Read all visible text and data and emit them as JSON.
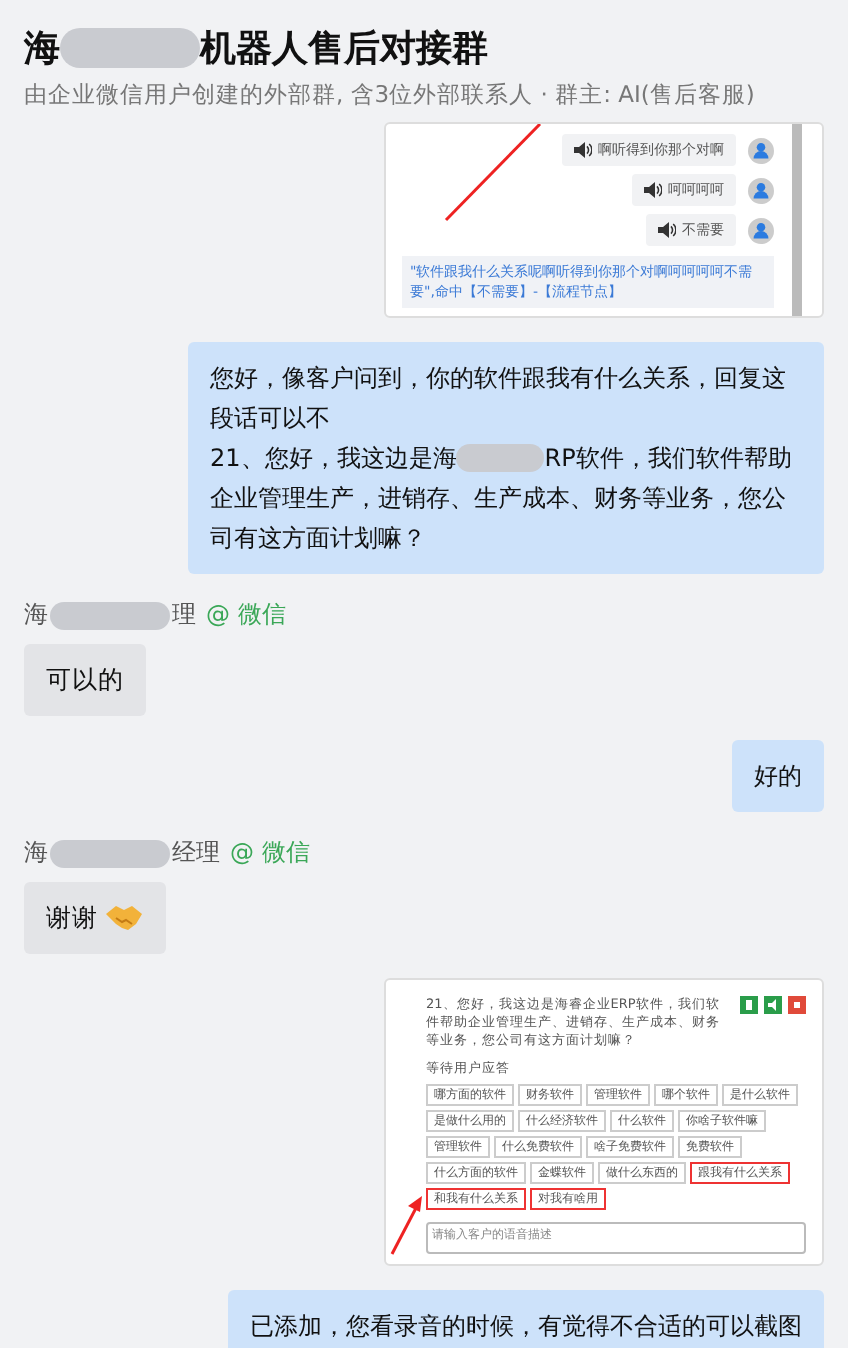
{
  "header": {
    "title_start": "海",
    "title_end": "机器人售后对接群",
    "subtitle": "由企业微信用户创建的外部群, 含3位外部联系人 · 群主: AI(售后客服)"
  },
  "messages": [
    {
      "kind": "voice_screenshot",
      "voices": [
        "啊听得到你那个对啊",
        "呵呵呵呵",
        "不需要"
      ],
      "note": "\"软件跟我什么关系呢啊听得到你那个对啊呵呵呵呵不需要\",命中【不需要】-【流程节点】"
    },
    {
      "kind": "sent_text",
      "lines": [
        [
          "您好，像客户问到，你的软件跟我有什么关系，回复这段话可以不"
        ],
        [
          "21、您好，我这边是海",
          "RP软件，我们软件帮助"
        ],
        [
          "企业管理生产，进销存、生产成本、财务等业务，您公司有这方面计划嘛？"
        ]
      ]
    },
    {
      "kind": "received_text",
      "sender": {
        "prefix": "海",
        "suffix": "理",
        "source": "@ 微信"
      },
      "parts": [
        "可以的"
      ]
    },
    {
      "kind": "sent_text",
      "lines": [
        [
          "好的"
        ]
      ]
    },
    {
      "kind": "received_text",
      "sender": {
        "prefix": "海",
        "suffix": "经理",
        "source": "@ 微信"
      },
      "parts": [
        "谢谢"
      ],
      "handshake": true
    },
    {
      "kind": "flow_screenshot",
      "question": "21、您好，我这边是海睿企业ERP软件，我们软件帮助企业管理生产、进销存、生产成本、财务等业务，您公司有这方面计划嘛？",
      "status": "等待用户应答",
      "tags": [
        {
          "label": "哪方面的软件",
          "selected": false
        },
        {
          "label": "财务软件",
          "selected": false
        },
        {
          "label": "管理软件",
          "selected": false
        },
        {
          "label": "哪个软件",
          "selected": false
        },
        {
          "label": "是什么软件",
          "selected": false
        },
        {
          "label": "是做什么用的",
          "selected": false
        },
        {
          "label": "什么经济软件",
          "selected": false
        },
        {
          "label": "什么软件",
          "selected": false
        },
        {
          "label": "你啥子软件嘛",
          "selected": false
        },
        {
          "label": "管理软件",
          "selected": false
        },
        {
          "label": "什么免费软件",
          "selected": false
        },
        {
          "label": "啥子免费软件",
          "selected": false
        },
        {
          "label": "免费软件",
          "selected": false
        },
        {
          "label": "什么方面的软件",
          "selected": false
        },
        {
          "label": "金蝶软件",
          "selected": false
        },
        {
          "label": "做什么东西的",
          "selected": false
        },
        {
          "label": "跟我有什么关系",
          "selected": true
        },
        {
          "label": "和我有什么关系",
          "selected": true
        },
        {
          "label": "对我有啥用",
          "selected": true
        }
      ],
      "placeholder": "请输入客户的语音描述"
    },
    {
      "kind": "sent_text",
      "lines": [
        [
          "已添加，您看录音的时候，有觉得不合适的可以截图"
        ]
      ]
    }
  ]
}
